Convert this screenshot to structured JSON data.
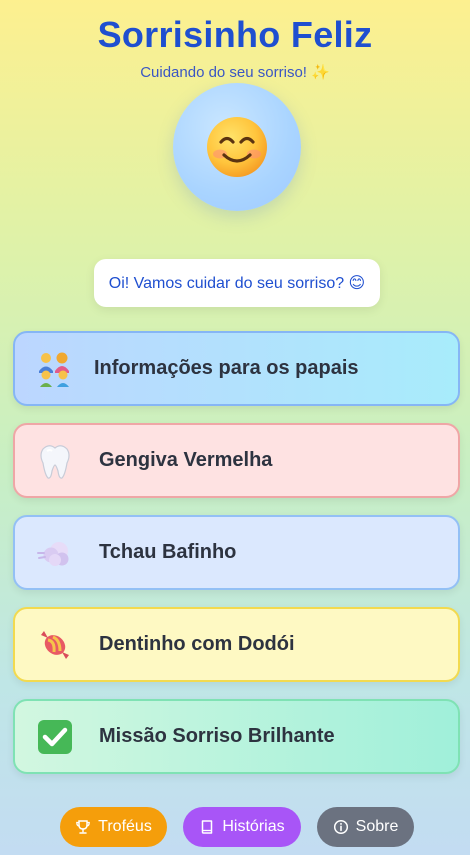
{
  "header": {
    "title": "Sorrisinho Feliz",
    "subtitle": "Cuidando do seu sorriso! ✨"
  },
  "avatar": {
    "icon": "smiling-face-icon"
  },
  "greeting": {
    "text": "Oi! Vamos cuidar do seu sorriso? 😊"
  },
  "menu": [
    {
      "label": "Informações para os papais",
      "icon": "family-icon"
    },
    {
      "label": "Gengiva Vermelha",
      "icon": "tooth-icon"
    },
    {
      "label": "Tchau Bafinho",
      "icon": "breath-cloud-icon"
    },
    {
      "label": "Dentinho com Dodói",
      "icon": "candy-icon"
    },
    {
      "label": "Missão Sorriso Brilhante",
      "icon": "check-mark-icon"
    }
  ],
  "footer": {
    "trophies_label": "Troféus",
    "stories_label": "Histórias",
    "about_label": "Sobre"
  },
  "colors": {
    "title": "#1f4fd0",
    "trophies_button": "#f59e0b",
    "stories_button": "#a855f7",
    "about_button": "#6b7280"
  }
}
